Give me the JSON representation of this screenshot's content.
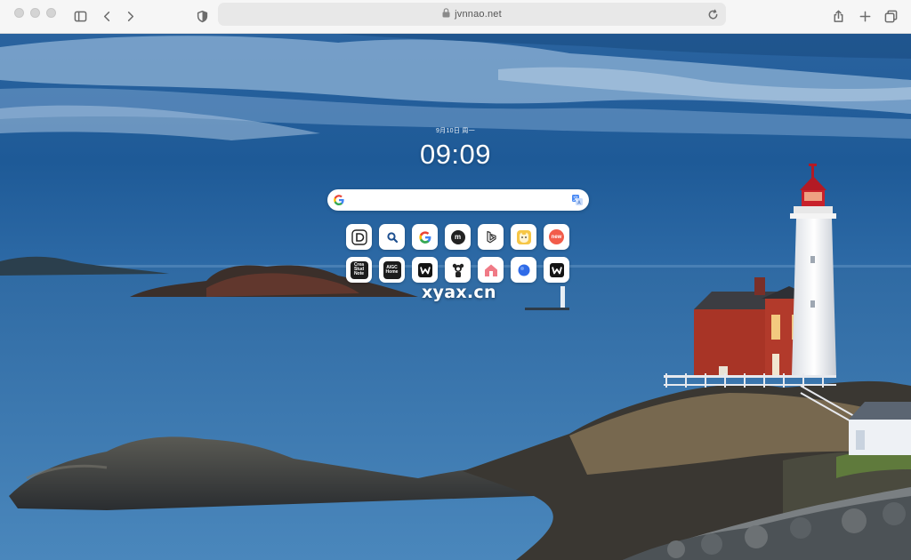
{
  "browser": {
    "url": "jvnnao.net",
    "icons": {
      "sidebar": "sidebar-icon",
      "back": "chevron-left-icon",
      "forward": "chevron-right-icon",
      "privacy": "shield-icon",
      "reload": "reload-icon",
      "share": "share-icon",
      "new_tab": "plus-icon",
      "tabs": "tab-overview-icon"
    }
  },
  "newtab": {
    "date": "9月10日 周一",
    "time": "09:09",
    "search": {
      "value": "",
      "engine_icon": "google-g-icon",
      "translate_icon": "translate-icon"
    },
    "shortcuts": [
      {
        "icon": "bracket-d-icon",
        "text": "",
        "bg": "#ffffff"
      },
      {
        "icon": "magnifier-icon",
        "text": "",
        "bg": "#ffffff"
      },
      {
        "icon": "google-icon",
        "text": "",
        "bg": "#ffffff"
      },
      {
        "icon": "m-circle-icon",
        "text": "m",
        "bg": "#ffffff"
      },
      {
        "icon": "bing-icon",
        "text": "",
        "bg": "#ffffff"
      },
      {
        "icon": "cat-face-icon",
        "text": "",
        "bg": "#ffffff"
      },
      {
        "icon": "new-badge-icon",
        "text": "new",
        "bg": "#ffffff"
      },
      {
        "icon": "dark-text-tile-icon",
        "text": "Crea Stud Note",
        "bg": "#ffffff"
      },
      {
        "icon": "dark-text-tile-icon",
        "text": "AIGC Home",
        "bg": "#ffffff"
      },
      {
        "icon": "w-logo-icon",
        "text": "",
        "bg": "#ffffff"
      },
      {
        "icon": "avatar-icon",
        "text": "",
        "bg": "#ffffff"
      },
      {
        "icon": "pink-house-icon",
        "text": "",
        "bg": "#ffffff"
      },
      {
        "icon": "blue-dot-icon",
        "text": "",
        "bg": "#ffffff"
      },
      {
        "icon": "w-logo-icon",
        "text": "",
        "bg": "#ffffff"
      }
    ]
  },
  "watermark": "xyax.cn",
  "colors": {
    "sky": "#1f5d9c",
    "sea": "#3f7cb4",
    "house": "#a83426",
    "lighthouse_top": "#c8212b"
  }
}
